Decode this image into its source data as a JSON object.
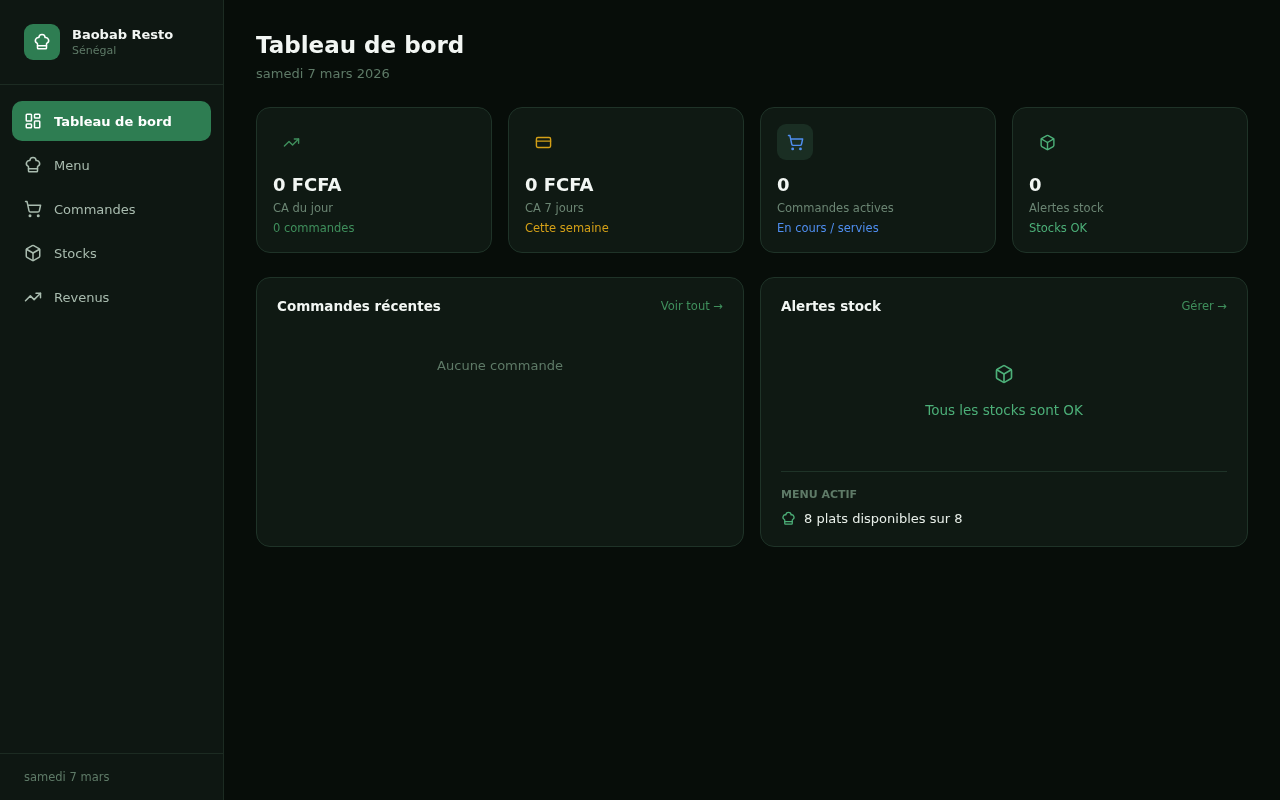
{
  "sidebar": {
    "brand": {
      "name": "Baobab Resto",
      "subtitle": "Sénégal"
    },
    "items": [
      {
        "label": "Tableau de bord",
        "kind": "grid",
        "selected": true
      },
      {
        "label": "Menu",
        "kind": "chef",
        "selected": false
      },
      {
        "label": "Commandes",
        "kind": "cart",
        "selected": false
      },
      {
        "label": "Stocks",
        "kind": "box",
        "selected": false
      },
      {
        "label": "Revenus",
        "kind": "trend",
        "selected": false
      }
    ],
    "footer": "samedi 7 mars"
  },
  "header": {
    "title": "Tableau de bord",
    "date": "samedi 7 mars 2026"
  },
  "stats": [
    {
      "kind": "trend",
      "value": "0 FCFA",
      "label": "CA du jour",
      "note": "0 commandes",
      "color": "#3f8f5c",
      "highlighted": false
    },
    {
      "kind": "card",
      "value": "0 FCFA",
      "label": "CA 7 jours",
      "note": "Cette semaine",
      "color": "#d4a017",
      "highlighted": false
    },
    {
      "kind": "cart",
      "value": "0",
      "label": "Commandes actives",
      "note": "En cours / servies",
      "color": "#4f8ef0",
      "highlighted": true
    },
    {
      "kind": "box",
      "value": "0",
      "label": "Alertes stock",
      "note": "Stocks OK",
      "color": "#4caf78",
      "highlighted": false
    }
  ],
  "recent_orders": {
    "title": "Commandes récentes",
    "link": "Voir tout →",
    "empty": "Aucune commande"
  },
  "stock_alerts": {
    "title": "Alertes stock",
    "link": "Gérer →",
    "empty": "Tous les stocks sont OK",
    "menu_heading": "MENU ACTIF",
    "menu_text": "8 plats disponibles sur 8"
  }
}
